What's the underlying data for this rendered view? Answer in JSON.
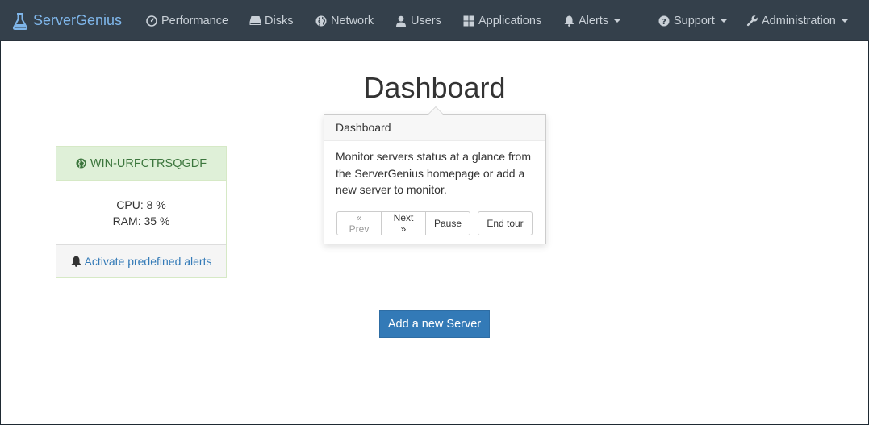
{
  "navbar": {
    "brand": "ServerGenius",
    "items": [
      {
        "label": "Performance",
        "icon": "dashboard-icon"
      },
      {
        "label": "Disks",
        "icon": "hdd-icon"
      },
      {
        "label": "Network",
        "icon": "globe-icon"
      },
      {
        "label": "Users",
        "icon": "user-icon"
      },
      {
        "label": "Applications",
        "icon": "grid-icon"
      },
      {
        "label": "Alerts",
        "icon": "bell-icon",
        "dropdown": true
      }
    ],
    "right_items": [
      {
        "label": "Support",
        "icon": "question-circle-icon",
        "dropdown": true
      },
      {
        "label": "Administration",
        "icon": "wrench-icon",
        "dropdown": true
      }
    ]
  },
  "page": {
    "title": "Dashboard"
  },
  "server": {
    "name": "WIN-URFCTRSQGDF",
    "cpu": "CPU: 8 %",
    "ram": "RAM: 35 %",
    "alerts_link": "Activate predefined alerts"
  },
  "tour": {
    "title": "Dashboard",
    "content": "Monitor servers status at a glance from the ServerGenius homepage or add a new server to monitor.",
    "prev": "« Prev",
    "next": "Next »",
    "pause": "Pause",
    "end": "End tour"
  },
  "actions": {
    "add_server": "Add a new Server"
  },
  "colors": {
    "navbar_bg": "#34404b",
    "brand": "#7fb6ea",
    "primary": "#337ab7",
    "success_bg": "#dff0d8",
    "success_text": "#3c763d"
  }
}
